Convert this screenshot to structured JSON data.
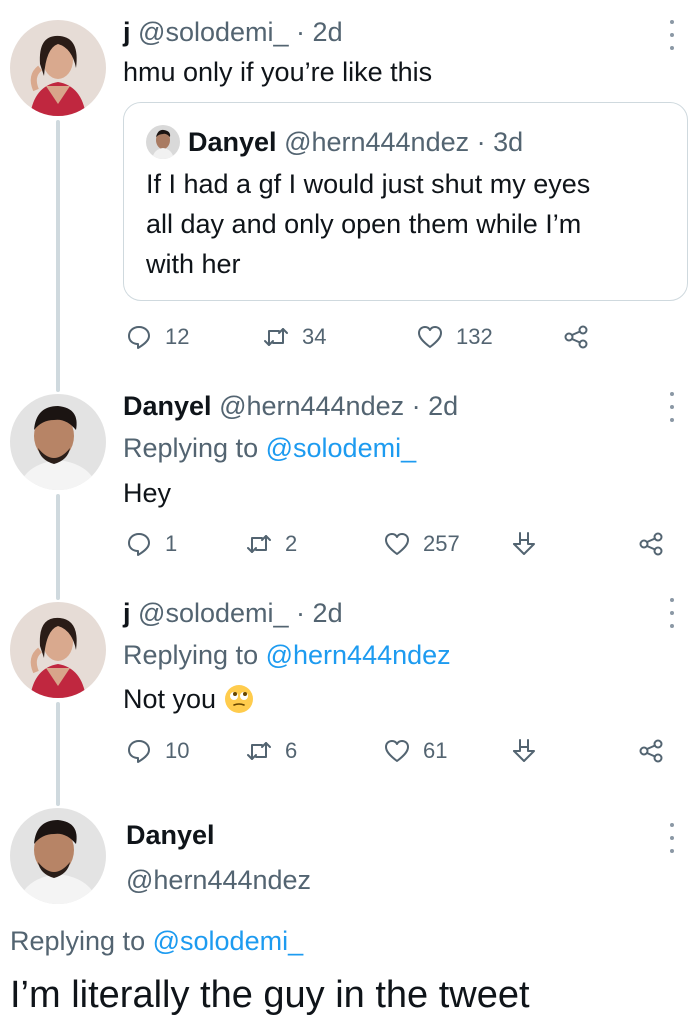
{
  "tweets": [
    {
      "name": "j",
      "handle": "@solodemi_",
      "time": "2d",
      "text": "hmu only if you’re like this",
      "quote": {
        "name": "Danyel",
        "handle": "@hern444ndez",
        "time": "3d",
        "lines": [
          "If I had a gf I would just shut my eyes",
          "all day and only open them while I’m",
          "with her"
        ]
      },
      "replies": "12",
      "retweets": "34",
      "likes": "132"
    },
    {
      "name": "Danyel",
      "handle": "@hern444ndez",
      "time": "2d",
      "replying_label": "Replying to",
      "replying_to": "@solodemi_",
      "text": "Hey",
      "replies": "1",
      "retweets": "2",
      "likes": "257"
    },
    {
      "name": "j",
      "handle": "@solodemi_",
      "time": "2d",
      "replying_label": "Replying to",
      "replying_to": "@hern444ndez",
      "text": "Not you",
      "emoji": "face-with-rolling-eyes",
      "replies": "10",
      "retweets": "6",
      "likes": "61"
    }
  ],
  "focused": {
    "name": "Danyel",
    "handle": "@hern444ndez",
    "replying_label": "Replying to",
    "replying_to": "@solodemi_",
    "text": "I’m literally the guy in the tweet"
  },
  "sep": "·",
  "colors": {
    "link": "#1d9bf0",
    "muted": "#536471",
    "border": "#cfd9de"
  }
}
